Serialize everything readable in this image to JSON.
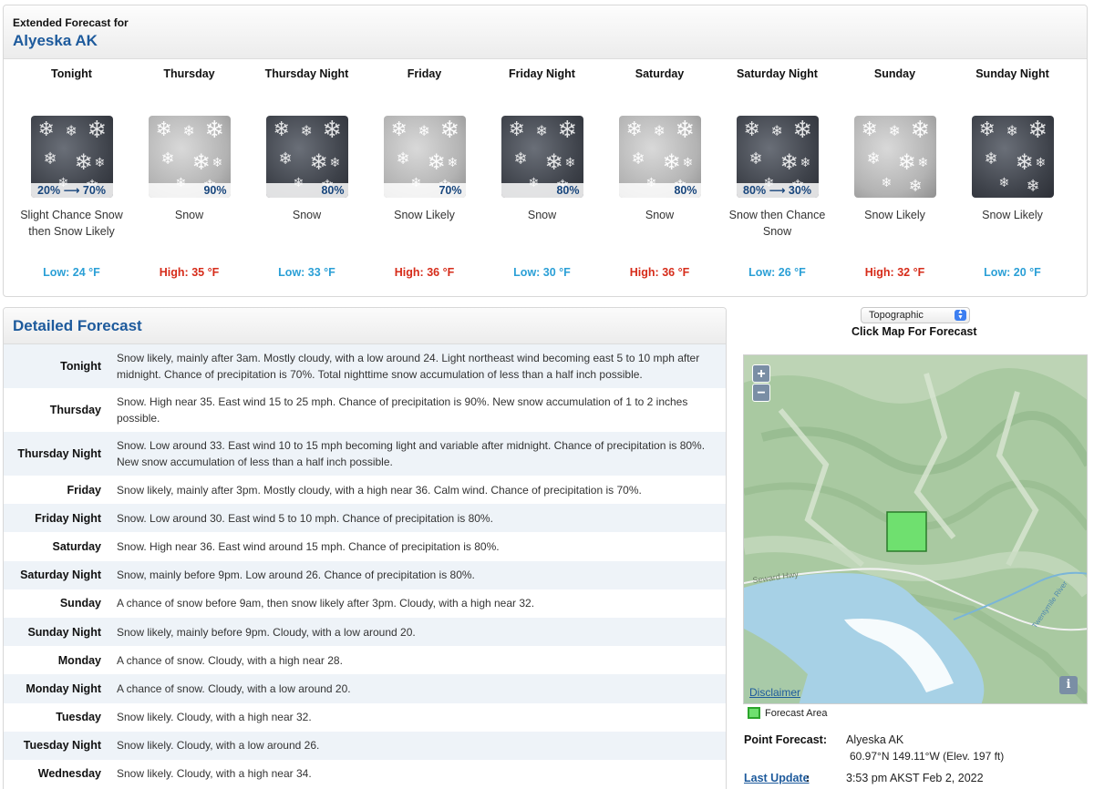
{
  "extended": {
    "header_small": "Extended Forecast for",
    "location": "Alyeska AK",
    "periods": [
      {
        "name": "Tonight",
        "icon": "snow-night-icon",
        "icon_style": "dark",
        "pop": "20% ⟶ 70%",
        "desc": "Slight Chance Snow then Snow Likely",
        "temp": "Low: 24 °F",
        "temp_type": "low"
      },
      {
        "name": "Thursday",
        "icon": "snow-day-icon",
        "icon_style": "light",
        "pop": "90%",
        "desc": "Snow",
        "temp": "High: 35 °F",
        "temp_type": "high"
      },
      {
        "name": "Thursday Night",
        "icon": "snow-night-icon",
        "icon_style": "dark",
        "pop": "80%",
        "desc": "Snow",
        "temp": "Low: 33 °F",
        "temp_type": "low"
      },
      {
        "name": "Friday",
        "icon": "snow-day-icon",
        "icon_style": "light",
        "pop": "70%",
        "desc": "Snow Likely",
        "temp": "High: 36 °F",
        "temp_type": "high"
      },
      {
        "name": "Friday Night",
        "icon": "snow-night-icon",
        "icon_style": "dark",
        "pop": "80%",
        "desc": "Snow",
        "temp": "Low: 30 °F",
        "temp_type": "low"
      },
      {
        "name": "Saturday",
        "icon": "snow-day-icon",
        "icon_style": "light",
        "pop": "80%",
        "desc": "Snow",
        "temp": "High: 36 °F",
        "temp_type": "high"
      },
      {
        "name": "Saturday Night",
        "icon": "snow-night-icon",
        "icon_style": "dark",
        "pop": "80% ⟶ 30%",
        "desc": "Snow then Chance Snow",
        "temp": "Low: 26 °F",
        "temp_type": "low"
      },
      {
        "name": "Sunday",
        "icon": "snow-day-icon",
        "icon_style": "light",
        "pop": "",
        "desc": "Snow Likely",
        "temp": "High: 32 °F",
        "temp_type": "high"
      },
      {
        "name": "Sunday Night",
        "icon": "snow-night-icon",
        "icon_style": "dark",
        "pop": "",
        "desc": "Snow Likely",
        "temp": "Low: 20 °F",
        "temp_type": "low"
      }
    ]
  },
  "detailed": {
    "title": "Detailed Forecast",
    "rows": [
      {
        "label": "Tonight",
        "text": "Snow likely, mainly after 3am. Mostly cloudy, with a low around 24. Light northeast wind becoming east 5 to 10 mph after midnight. Chance of precipitation is 70%. Total nighttime snow accumulation of less than a half inch possible.",
        "lines": 2
      },
      {
        "label": "Thursday",
        "text": "Snow. High near 35. East wind 15 to 25 mph. Chance of precipitation is 90%. New snow accumulation of 1 to 2 inches possible.",
        "lines": 2
      },
      {
        "label": "Thursday Night",
        "text": "Snow. Low around 33. East wind 10 to 15 mph becoming light and variable after midnight. Chance of precipitation is 80%. New snow accumulation of less than a half inch possible.",
        "lines": 2
      },
      {
        "label": "Friday",
        "text": "Snow likely, mainly after 3pm. Mostly cloudy, with a high near 36. Calm wind. Chance of precipitation is 70%.",
        "lines": 1
      },
      {
        "label": "Friday Night",
        "text": "Snow. Low around 30. East wind 5 to 10 mph. Chance of precipitation is 80%.",
        "lines": 1
      },
      {
        "label": "Saturday",
        "text": "Snow. High near 36. East wind around 15 mph. Chance of precipitation is 80%.",
        "lines": 1
      },
      {
        "label": "Saturday Night",
        "text": "Snow, mainly before 9pm. Low around 26. Chance of precipitation is 80%.",
        "lines": 1
      },
      {
        "label": "Sunday",
        "text": "A chance of snow before 9am, then snow likely after 3pm. Cloudy, with a high near 32.",
        "lines": 1
      },
      {
        "label": "Sunday Night",
        "text": "Snow likely, mainly before 9pm. Cloudy, with a low around 20.",
        "lines": 1
      },
      {
        "label": "Monday",
        "text": "A chance of snow. Cloudy, with a high near 28.",
        "lines": 1
      },
      {
        "label": "Monday Night",
        "text": "A chance of snow. Cloudy, with a low around 20.",
        "lines": 1
      },
      {
        "label": "Tuesday",
        "text": "Snow likely. Cloudy, with a high near 32.",
        "lines": 1
      },
      {
        "label": "Tuesday Night",
        "text": "Snow likely. Cloudy, with a low around 26.",
        "lines": 1
      },
      {
        "label": "Wednesday",
        "text": "Snow likely. Cloudy, with a high near 34.",
        "lines": 1
      }
    ]
  },
  "map": {
    "select_value": "Topographic",
    "click_label": "Click Map For Forecast",
    "zoom_in": "+",
    "zoom_out": "−",
    "road_label": "Seward Hwy",
    "river_label": "Twentymile River",
    "disclaimer": "Disclaimer",
    "info": "i",
    "legend": "Forecast Area",
    "forecast_area_color": "#6fe06f"
  },
  "point": {
    "label": "Point Forecast:",
    "name": "Alyeska AK",
    "coords": "60.97°N 149.11°W (Elev. 197 ft)",
    "last_update_label": "Last Update",
    "last_update_colon": ":",
    "last_update_value": "3:53 pm AKST Feb 2, 2022"
  }
}
